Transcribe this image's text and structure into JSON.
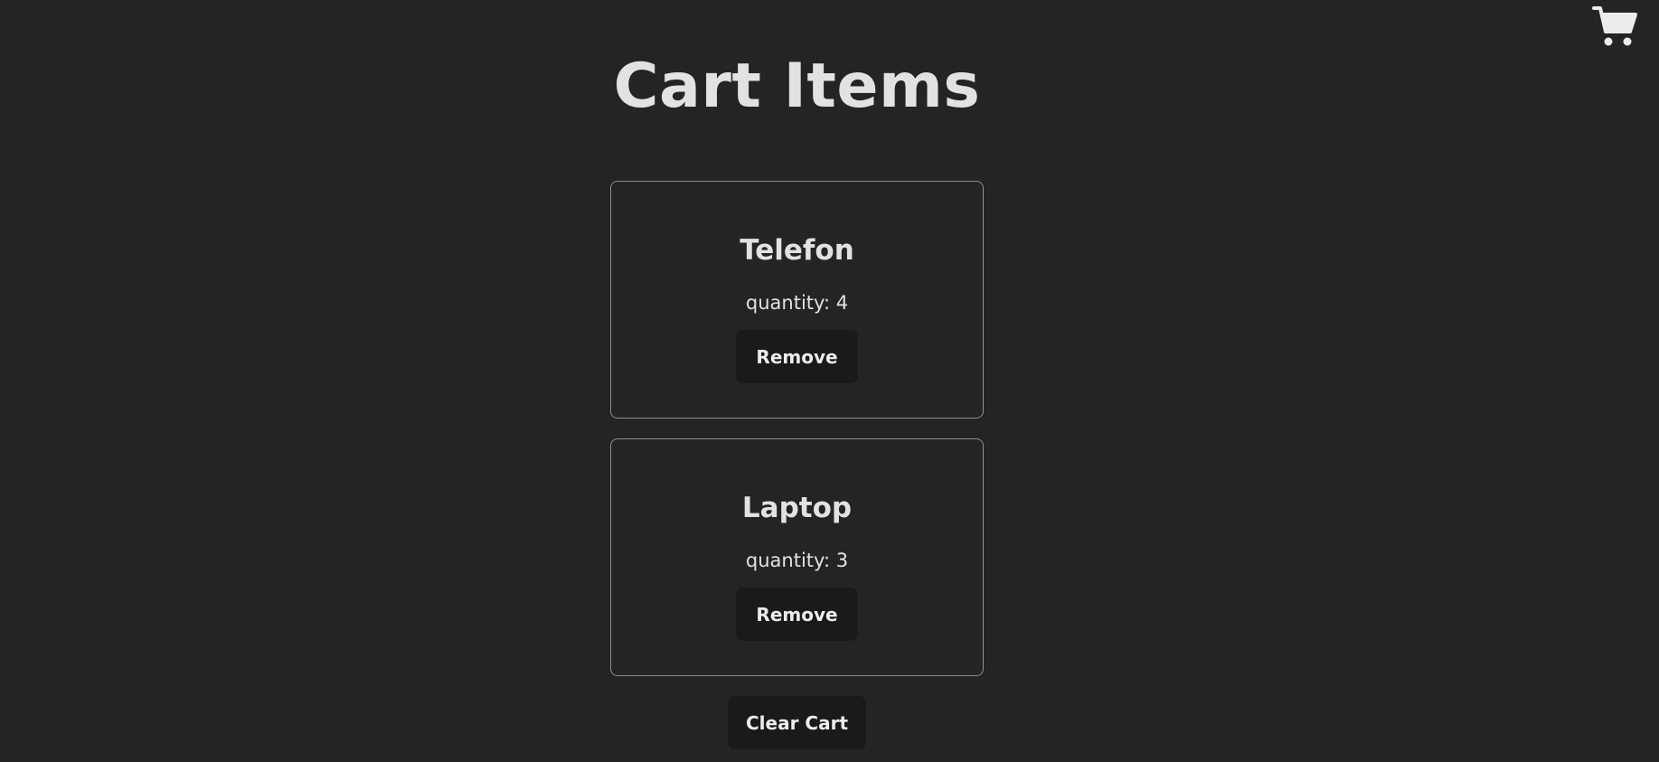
{
  "header": {
    "title": "Cart Items",
    "cart_icon": "shopping-cart-icon"
  },
  "cart": {
    "items": [
      {
        "name": "Telefon",
        "quantity_text": "quantity: 4",
        "remove_label": "Remove"
      },
      {
        "name": "Laptop",
        "quantity_text": "quantity: 3",
        "remove_label": "Remove"
      }
    ],
    "clear_label": "Clear Cart"
  },
  "colors": {
    "background": "#242424",
    "button_bg": "#1a1a1a",
    "card_border": "#8f8f8f"
  }
}
